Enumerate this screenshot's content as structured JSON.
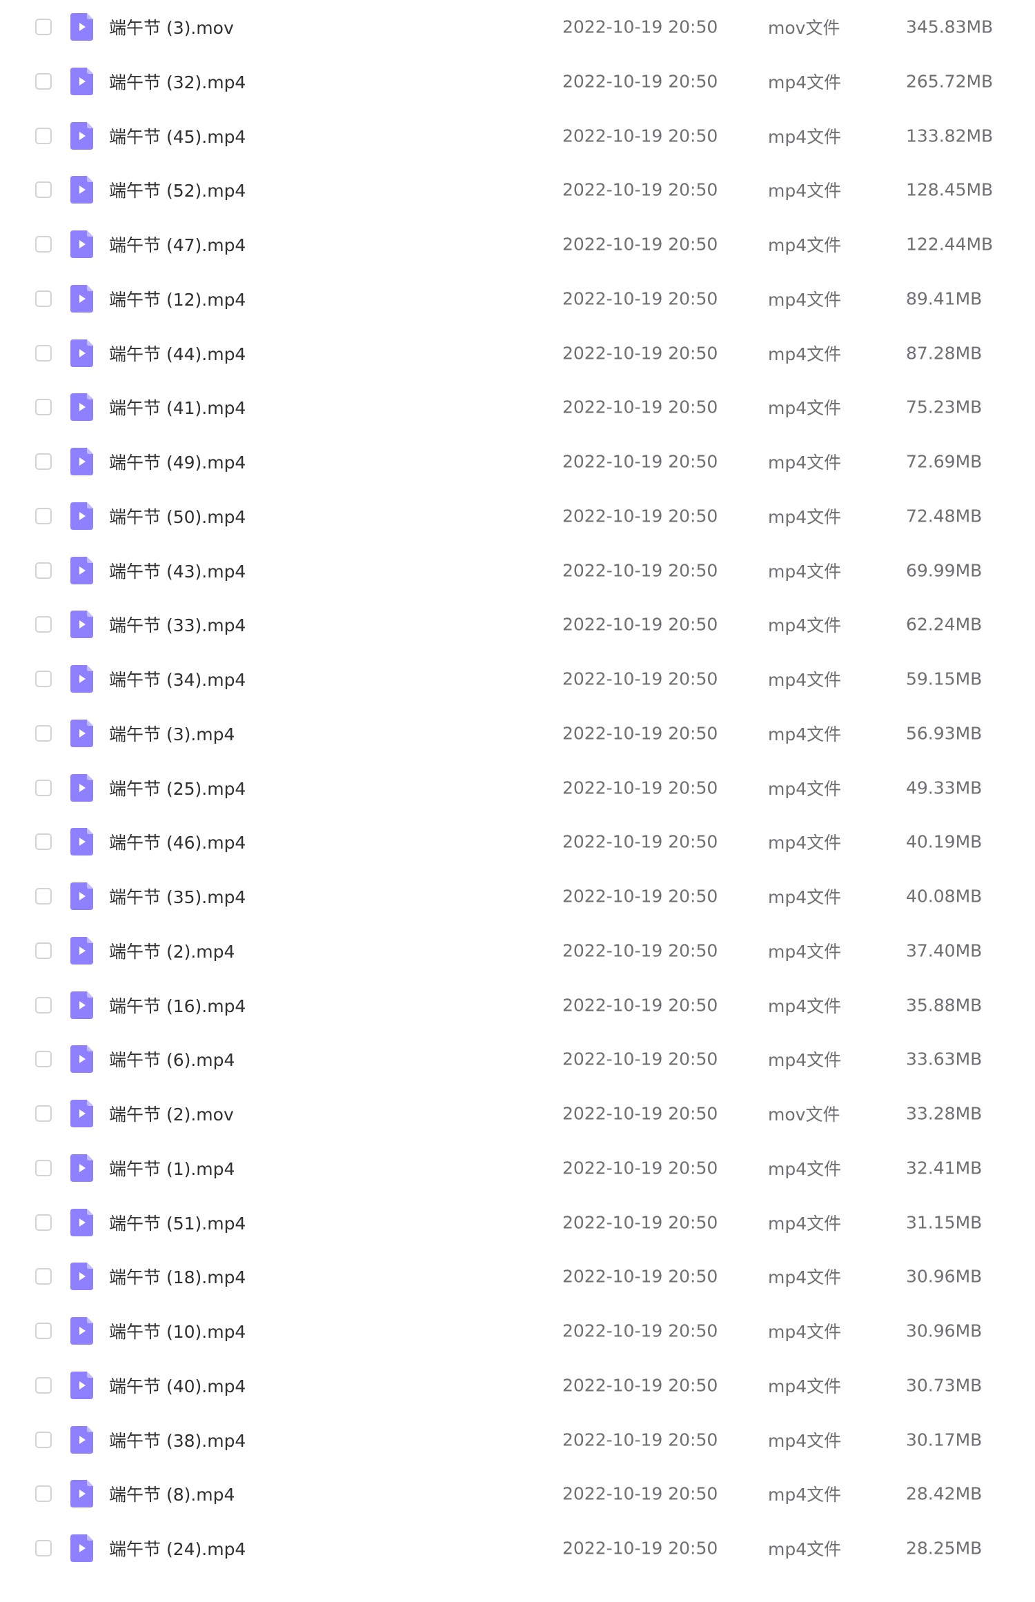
{
  "colors": {
    "icon_fill": "#8f80ff",
    "icon_fold": "#c3bbff",
    "text_primary": "#303030",
    "text_secondary": "#6f6f74",
    "checkbox_border": "#d3d3d6"
  },
  "icons": {
    "row_icon": "video-file-icon",
    "row_checkbox": "checkbox"
  },
  "files": [
    {
      "name": "端午节 (3).mov",
      "date": "2022-10-19 20:50",
      "type": "mov文件",
      "size": "345.83MB"
    },
    {
      "name": "端午节 (32).mp4",
      "date": "2022-10-19 20:50",
      "type": "mp4文件",
      "size": "265.72MB"
    },
    {
      "name": "端午节 (45).mp4",
      "date": "2022-10-19 20:50",
      "type": "mp4文件",
      "size": "133.82MB"
    },
    {
      "name": "端午节 (52).mp4",
      "date": "2022-10-19 20:50",
      "type": "mp4文件",
      "size": "128.45MB"
    },
    {
      "name": "端午节 (47).mp4",
      "date": "2022-10-19 20:50",
      "type": "mp4文件",
      "size": "122.44MB"
    },
    {
      "name": "端午节 (12).mp4",
      "date": "2022-10-19 20:50",
      "type": "mp4文件",
      "size": "89.41MB"
    },
    {
      "name": "端午节 (44).mp4",
      "date": "2022-10-19 20:50",
      "type": "mp4文件",
      "size": "87.28MB"
    },
    {
      "name": "端午节 (41).mp4",
      "date": "2022-10-19 20:50",
      "type": "mp4文件",
      "size": "75.23MB"
    },
    {
      "name": "端午节 (49).mp4",
      "date": "2022-10-19 20:50",
      "type": "mp4文件",
      "size": "72.69MB"
    },
    {
      "name": "端午节 (50).mp4",
      "date": "2022-10-19 20:50",
      "type": "mp4文件",
      "size": "72.48MB"
    },
    {
      "name": "端午节 (43).mp4",
      "date": "2022-10-19 20:50",
      "type": "mp4文件",
      "size": "69.99MB"
    },
    {
      "name": "端午节 (33).mp4",
      "date": "2022-10-19 20:50",
      "type": "mp4文件",
      "size": "62.24MB"
    },
    {
      "name": "端午节 (34).mp4",
      "date": "2022-10-19 20:50",
      "type": "mp4文件",
      "size": "59.15MB"
    },
    {
      "name": "端午节 (3).mp4",
      "date": "2022-10-19 20:50",
      "type": "mp4文件",
      "size": "56.93MB"
    },
    {
      "name": "端午节 (25).mp4",
      "date": "2022-10-19 20:50",
      "type": "mp4文件",
      "size": "49.33MB"
    },
    {
      "name": "端午节 (46).mp4",
      "date": "2022-10-19 20:50",
      "type": "mp4文件",
      "size": "40.19MB"
    },
    {
      "name": "端午节 (35).mp4",
      "date": "2022-10-19 20:50",
      "type": "mp4文件",
      "size": "40.08MB"
    },
    {
      "name": "端午节 (2).mp4",
      "date": "2022-10-19 20:50",
      "type": "mp4文件",
      "size": "37.40MB"
    },
    {
      "name": "端午节 (16).mp4",
      "date": "2022-10-19 20:50",
      "type": "mp4文件",
      "size": "35.88MB"
    },
    {
      "name": "端午节 (6).mp4",
      "date": "2022-10-19 20:50",
      "type": "mp4文件",
      "size": "33.63MB"
    },
    {
      "name": "端午节 (2).mov",
      "date": "2022-10-19 20:50",
      "type": "mov文件",
      "size": "33.28MB"
    },
    {
      "name": "端午节 (1).mp4",
      "date": "2022-10-19 20:50",
      "type": "mp4文件",
      "size": "32.41MB"
    },
    {
      "name": "端午节 (51).mp4",
      "date": "2022-10-19 20:50",
      "type": "mp4文件",
      "size": "31.15MB"
    },
    {
      "name": "端午节 (18).mp4",
      "date": "2022-10-19 20:50",
      "type": "mp4文件",
      "size": "30.96MB"
    },
    {
      "name": "端午节 (10).mp4",
      "date": "2022-10-19 20:50",
      "type": "mp4文件",
      "size": "30.96MB"
    },
    {
      "name": "端午节 (40).mp4",
      "date": "2022-10-19 20:50",
      "type": "mp4文件",
      "size": "30.73MB"
    },
    {
      "name": "端午节 (38).mp4",
      "date": "2022-10-19 20:50",
      "type": "mp4文件",
      "size": "30.17MB"
    },
    {
      "name": "端午节 (8).mp4",
      "date": "2022-10-19 20:50",
      "type": "mp4文件",
      "size": "28.42MB"
    },
    {
      "name": "端午节 (24).mp4",
      "date": "2022-10-19 20:50",
      "type": "mp4文件",
      "size": "28.25MB"
    }
  ]
}
